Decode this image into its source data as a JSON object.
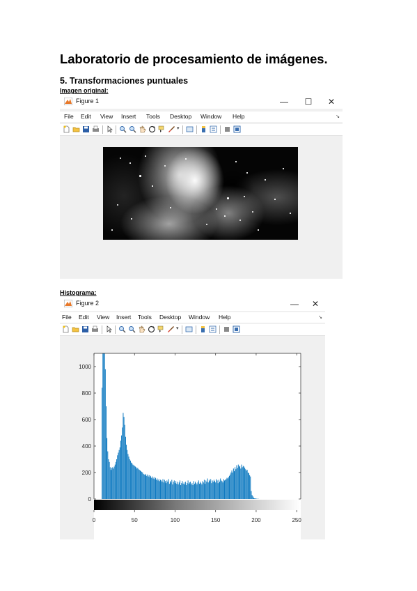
{
  "document": {
    "title": "Laboratorio de procesamiento de imágenes.",
    "section": "5. Transformaciones puntuales",
    "caption_original": "Imagen original:",
    "caption_histogram": "Histograma:"
  },
  "figure1": {
    "title": "Figure 1",
    "window_controls": {
      "minimize": "—",
      "maximize": "☐",
      "close": "✕"
    },
    "menu": [
      "File",
      "Edit",
      "View",
      "Insert",
      "Tools",
      "Desktop",
      "Window",
      "Help"
    ],
    "menu_corner": "↘",
    "toolbar_icons": [
      "new-figure-icon",
      "open-file-icon",
      "save-icon",
      "print-icon",
      "pointer-icon",
      "zoom-in-icon",
      "zoom-out-icon",
      "pan-icon",
      "rotate-3d-icon",
      "data-cursor-icon",
      "brush-icon",
      "link-plot-icon",
      "colorbar-icon",
      "legend-icon",
      "hide-plot-tools-icon",
      "show-plot-tools-icon"
    ]
  },
  "figure2": {
    "title": "Figure 2",
    "window_controls": {
      "minimize": "—",
      "close": "✕"
    },
    "menu": [
      "File",
      "Edit",
      "View",
      "Insert",
      "Tools",
      "Desktop",
      "Window",
      "Help"
    ],
    "menu_corner": "↘",
    "toolbar_icons": [
      "new-figure-icon",
      "open-file-icon",
      "save-icon",
      "print-icon",
      "pointer-icon",
      "zoom-in-icon",
      "zoom-out-icon",
      "pan-icon",
      "rotate-3d-icon",
      "data-cursor-icon",
      "brush-icon",
      "link-plot-icon",
      "colorbar-icon",
      "legend-icon",
      "hide-plot-tools-icon",
      "show-plot-tools-icon"
    ]
  },
  "colors": {
    "bar": "#0072bd",
    "figure_bg": "#f0f0f0",
    "axes_bg": "#ffffff"
  },
  "chart_data": {
    "type": "bar",
    "title": "",
    "xlabel": "",
    "ylabel": "",
    "xlim": [
      0,
      255
    ],
    "ylim": [
      0,
      1100
    ],
    "x_ticks": [
      "0",
      "50",
      "100",
      "150",
      "200",
      "250"
    ],
    "y_ticks": [
      "0",
      "200",
      "400",
      "600",
      "800",
      "1000"
    ],
    "grid": false,
    "colorbar": "grayscale",
    "x": [
      10,
      11,
      12,
      13,
      14,
      15,
      16,
      17,
      18,
      19,
      20,
      21,
      22,
      23,
      24,
      25,
      26,
      27,
      28,
      29,
      30,
      31,
      32,
      33,
      34,
      35,
      36,
      37,
      38,
      39,
      40,
      41,
      42,
      43,
      44,
      45,
      46,
      47,
      48,
      49,
      50,
      51,
      52,
      53,
      54,
      55,
      56,
      57,
      58,
      59,
      60,
      61,
      62,
      63,
      64,
      65,
      66,
      67,
      68,
      69,
      70,
      71,
      72,
      73,
      74,
      75,
      76,
      77,
      78,
      79,
      80,
      81,
      82,
      83,
      84,
      85,
      86,
      87,
      88,
      89,
      90,
      91,
      92,
      93,
      94,
      95,
      96,
      97,
      98,
      99,
      100,
      101,
      102,
      103,
      104,
      105,
      106,
      107,
      108,
      109,
      110,
      111,
      112,
      113,
      114,
      115,
      116,
      117,
      118,
      119,
      120,
      121,
      122,
      123,
      124,
      125,
      126,
      127,
      128,
      129,
      130,
      131,
      132,
      133,
      134,
      135,
      136,
      137,
      138,
      139,
      140,
      141,
      142,
      143,
      144,
      145,
      146,
      147,
      148,
      149,
      150,
      151,
      152,
      153,
      154,
      155,
      156,
      157,
      158,
      159,
      160,
      161,
      162,
      163,
      164,
      165,
      166,
      167,
      168,
      169,
      170,
      171,
      172,
      173,
      174,
      175,
      176,
      177,
      178,
      179,
      180,
      181,
      182,
      183,
      184,
      185,
      186,
      187,
      188,
      189,
      190,
      191,
      192,
      193,
      194,
      195,
      196,
      197,
      198,
      199,
      200,
      201,
      202,
      203,
      204,
      205,
      206,
      207,
      208,
      209,
      210,
      211,
      212,
      213,
      214,
      215,
      216,
      217,
      218,
      219,
      220,
      221,
      222,
      223,
      224,
      225,
      226,
      227,
      228,
      229,
      230,
      231,
      232,
      233,
      234,
      235,
      236,
      237,
      238,
      239,
      240,
      241,
      242,
      243,
      244,
      245,
      246,
      247,
      248,
      249,
      250,
      251,
      252,
      253,
      254,
      255
    ],
    "values": [
      840,
      1110,
      1110,
      1110,
      980,
      700,
      460,
      360,
      300,
      280,
      240,
      220,
      235,
      240,
      230,
      245,
      260,
      280,
      300,
      330,
      350,
      370,
      390,
      440,
      480,
      540,
      650,
      620,
      560,
      470,
      410,
      370,
      340,
      320,
      300,
      290,
      275,
      270,
      260,
      255,
      250,
      245,
      240,
      230,
      235,
      225,
      220,
      215,
      210,
      205,
      200,
      190,
      185,
      180,
      190,
      175,
      185,
      170,
      180,
      165,
      175,
      160,
      170,
      155,
      165,
      150,
      160,
      145,
      155,
      140,
      150,
      135,
      145,
      140,
      130,
      150,
      125,
      145,
      135,
      120,
      140,
      130,
      150,
      115,
      135,
      125,
      145,
      110,
      130,
      140,
      120,
      135,
      115,
      130,
      110,
      125,
      140,
      105,
      120,
      135,
      115,
      125,
      110,
      130,
      105,
      120,
      140,
      115,
      125,
      130,
      110,
      120,
      105,
      135,
      115,
      130,
      120,
      110,
      125,
      140,
      115,
      130,
      120,
      110,
      135,
      125,
      145,
      115,
      140,
      130,
      155,
      125,
      145,
      135,
      150,
      120,
      140,
      130,
      145,
      135,
      125,
      150,
      140,
      120,
      145,
      130,
      155,
      140,
      135,
      125,
      150,
      140,
      145,
      150,
      160,
      155,
      165,
      175,
      185,
      200,
      215,
      200,
      230,
      210,
      240,
      225,
      255,
      235,
      260,
      245,
      250,
      230,
      260,
      240,
      250,
      245,
      235,
      225,
      215,
      220,
      200,
      195,
      180,
      170,
      60,
      30,
      20,
      10,
      5,
      5,
      3,
      2,
      1,
      1,
      0,
      0,
      0,
      0,
      0,
      0,
      0,
      0,
      0,
      0,
      0,
      0,
      0,
      0,
      0,
      0,
      0,
      0,
      0,
      0,
      0,
      0,
      0,
      0,
      0,
      0,
      0,
      0,
      0,
      0,
      0,
      0,
      0,
      0,
      0,
      0,
      0,
      0,
      0,
      0,
      0,
      0,
      0,
      0,
      0,
      0,
      0,
      0,
      0,
      0,
      0,
      0,
      0,
      0,
      0,
      0,
      0,
      0,
      0,
      0,
      0,
      0,
      0,
      0,
      0,
      0,
      0,
      0,
      0,
      0,
      0,
      0,
      0,
      0,
      0,
      0,
      0,
      0,
      0,
      0,
      0
    ]
  }
}
